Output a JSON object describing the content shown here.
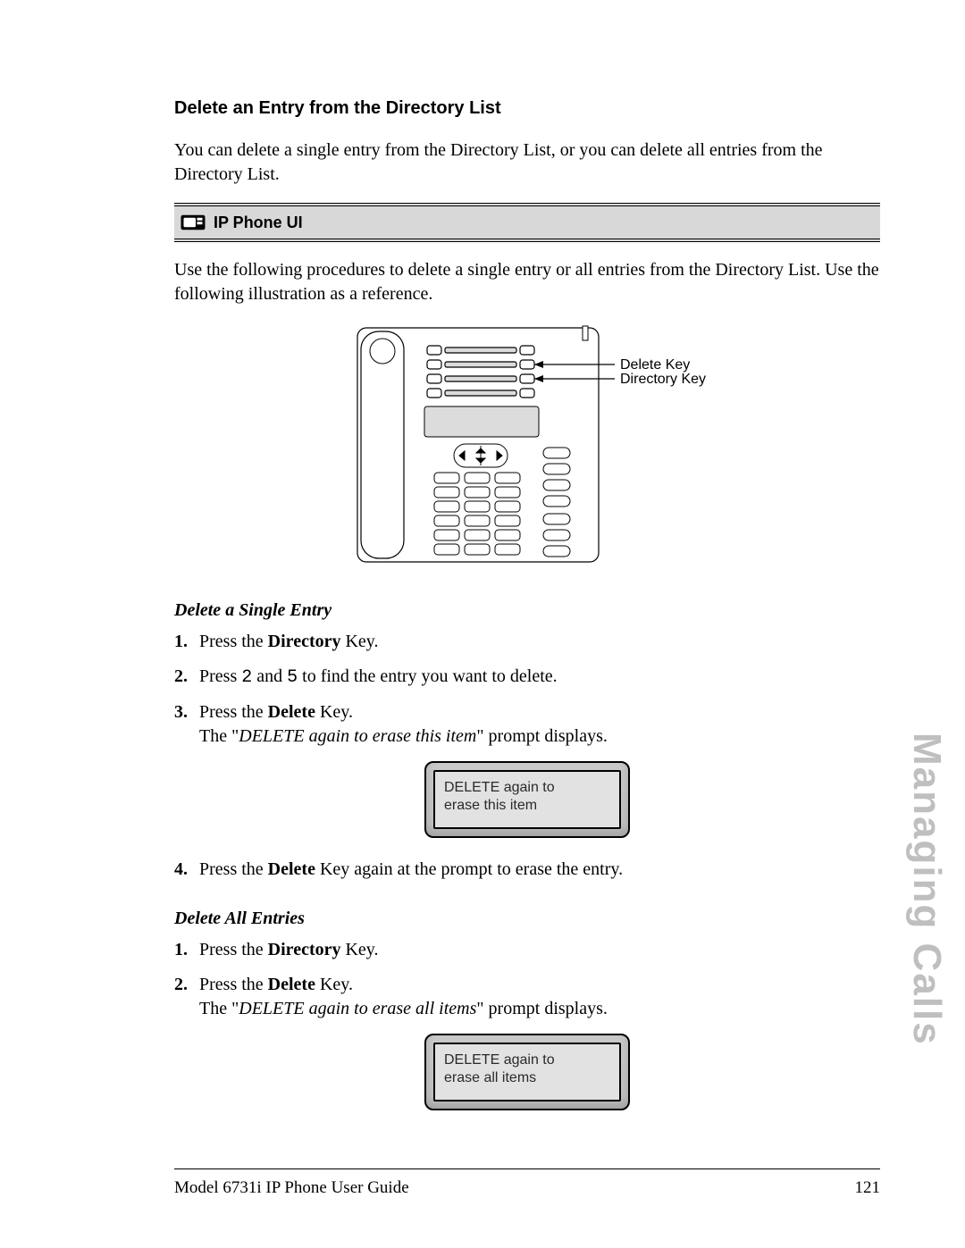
{
  "section_title": "Delete an Entry from the Directory List",
  "intro": "You can delete a single entry from the Directory List, or you can delete all entries from the Directory List.",
  "callout_bar": {
    "label": "IP Phone UI"
  },
  "procedure_lead": "Use the following procedures to delete a single entry or all entries from the Directory List. Use the following illustration as a reference.",
  "phone_labels": {
    "delete_key": "Delete Key",
    "directory_key": "Directory Key"
  },
  "single": {
    "heading": "Delete a Single Entry",
    "steps": [
      {
        "pre": "Press the ",
        "bold": "Directory",
        "post": " Key."
      },
      {
        "pre": "Press ",
        "k1": "2",
        "mid": " and ",
        "k2": "5",
        "post": " to find the entry you want to delete."
      },
      {
        "pre": "Press the ",
        "bold": "Delete",
        "post": " Key.",
        "result_pre": "The \"",
        "result_em": "DELETE again to erase this item",
        "result_post": "\" prompt displays."
      },
      {
        "pre": "Press the ",
        "bold": "Delete",
        "post": " Key again at the prompt to erase the entry."
      }
    ],
    "lcd_l1": "DELETE again to",
    "lcd_l2": "erase this item"
  },
  "all": {
    "heading": "Delete All Entries",
    "steps": [
      {
        "pre": "Press the ",
        "bold": "Directory",
        "post": " Key."
      },
      {
        "pre": "Press the ",
        "bold": "Delete",
        "post": " Key.",
        "result_pre": "The \"",
        "result_em": "DELETE again to erase all items",
        "result_post": "\" prompt displays."
      }
    ],
    "lcd_l1": "DELETE again to",
    "lcd_l2": "erase all items"
  },
  "side_tab": "Managing Calls",
  "footer": {
    "left": "Model 6731i IP Phone User Guide",
    "right": "121"
  }
}
